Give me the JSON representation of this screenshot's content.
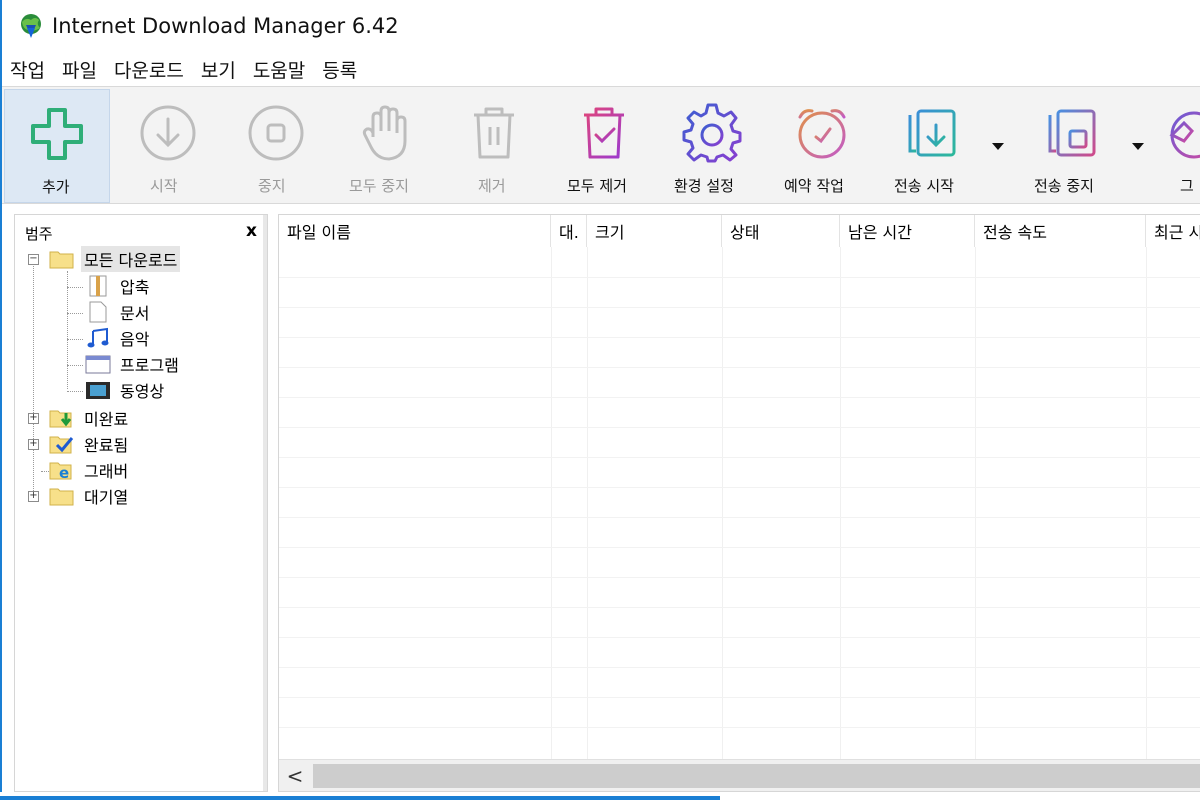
{
  "window": {
    "title": "Internet Download Manager 6.42"
  },
  "menu": [
    "작업",
    "파일",
    "다운로드",
    "보기",
    "도움말",
    "등록"
  ],
  "toolbar": [
    {
      "label": "추가",
      "icon": "add-plus-icon",
      "state": "active"
    },
    {
      "label": "시작",
      "icon": "download-start-icon",
      "state": "disabled"
    },
    {
      "label": "중지",
      "icon": "stop-icon",
      "state": "disabled"
    },
    {
      "label": "모두 중지",
      "icon": "hand-stop-all-icon",
      "state": "disabled"
    },
    {
      "label": "제거",
      "icon": "trash-icon",
      "state": "disabled"
    },
    {
      "label": "모두 제거",
      "icon": "trash-check-icon",
      "state": "enabled"
    },
    {
      "label": "환경 설정",
      "icon": "gear-icon",
      "state": "enabled"
    },
    {
      "label": "예약 작업",
      "icon": "alarm-clock-icon",
      "state": "enabled"
    },
    {
      "label": "전송 시작",
      "icon": "queue-start-icon",
      "state": "enabled"
    },
    {
      "label": "전송 중지",
      "icon": "queue-stop-icon",
      "state": "enabled"
    },
    {
      "label": "그",
      "icon": "grabber-icon",
      "state": "enabled"
    }
  ],
  "categories": {
    "header": "범주",
    "close": "x",
    "root": "모든 다운로드",
    "children": [
      "압축",
      "문서",
      "음악",
      "프로그램",
      "동영상"
    ],
    "others": [
      "미완료",
      "완료됨",
      "그래버",
      "대기열"
    ]
  },
  "list": {
    "columns": [
      "파일 이름",
      "대.",
      "크기",
      "상태",
      "남은 시간",
      "전송 속도",
      "최근 시"
    ],
    "scroll_left": "<"
  },
  "colors": {
    "accent": "#1a7fd4",
    "add_green": "#3cc28a",
    "trash_pink": "#c93a8a",
    "gear_purple": "#6a45c9"
  }
}
